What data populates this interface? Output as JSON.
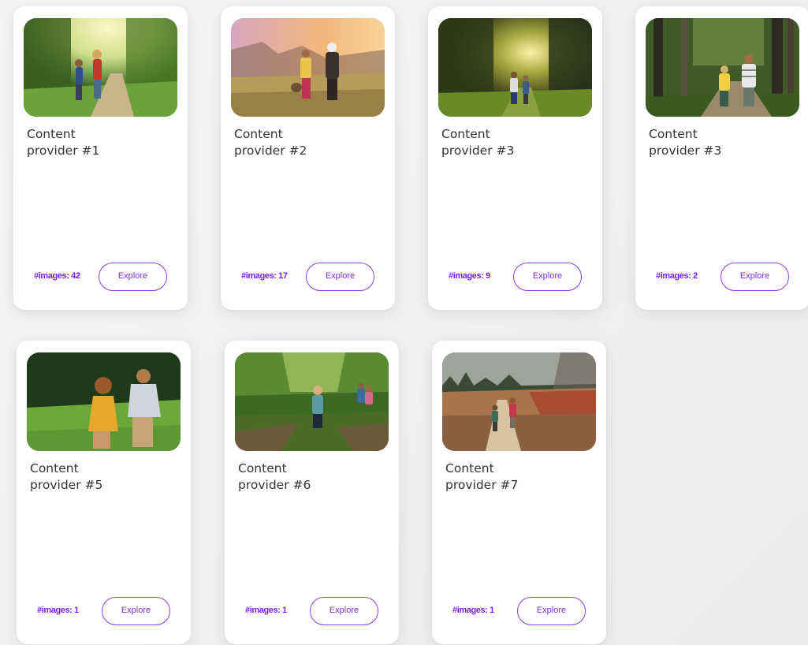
{
  "cards": [
    {
      "title_line1": "Content",
      "title_line2": "provider #1",
      "count_label": "#images: 42",
      "button_label": "Explore",
      "image": "children-walking-forest-path"
    },
    {
      "title_line1": "Content",
      "title_line2": "provider #2",
      "count_label": "#images: 17",
      "button_label": "Explore",
      "image": "children-meadow-sunset"
    },
    {
      "title_line1": "Content",
      "title_line2": "provider #3",
      "count_label": "#images: 9",
      "button_label": "Explore",
      "image": "children-sunlit-forest"
    },
    {
      "title_line1": "Content",
      "title_line2": "provider #3",
      "count_label": "#images: 2",
      "button_label": "Explore",
      "image": "children-woodland-trail"
    },
    {
      "title_line1": "Content",
      "title_line2": "provider #5",
      "count_label": "#images: 1",
      "button_label": "Explore",
      "image": "children-running-grass"
    },
    {
      "title_line1": "Content",
      "title_line2": "provider #6",
      "count_label": "#images: 1",
      "button_label": "Explore",
      "image": "children-green-woods"
    },
    {
      "title_line1": "Content",
      "title_line2": "provider #7",
      "count_label": "#images: 1",
      "button_label": "Explore",
      "image": "children-autumn-field"
    }
  ],
  "colors": {
    "accent": "#7a1fe6",
    "button_border": "#8b3fe0"
  }
}
